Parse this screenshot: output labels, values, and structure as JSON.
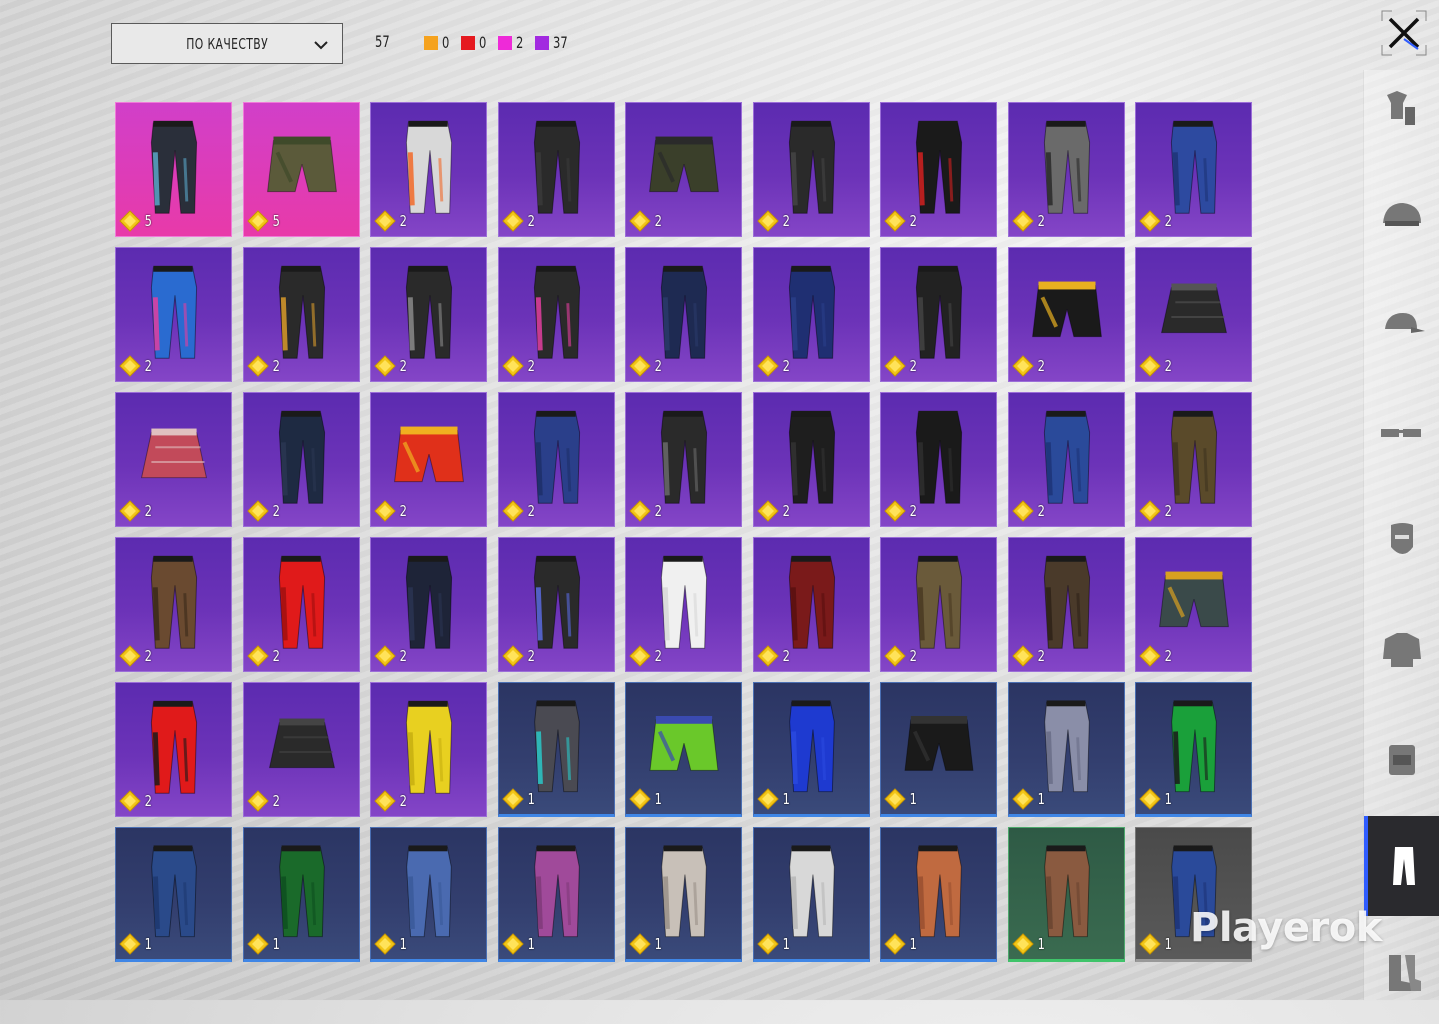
{
  "sort": {
    "label": "ПО КАЧЕСТВУ"
  },
  "stats": {
    "total": "57",
    "counts": [
      {
        "color": "#f5a21e",
        "value": "0"
      },
      {
        "color": "#e5191f",
        "value": "0"
      },
      {
        "color": "#ee2ad8",
        "value": "2"
      },
      {
        "color": "#a22ae0",
        "value": "37"
      }
    ]
  },
  "watermark": "Playerok",
  "nav": [
    {
      "icon": "outfit-icon"
    },
    {
      "icon": "helmet-icon"
    },
    {
      "icon": "cap-icon"
    },
    {
      "icon": "glasses-icon"
    },
    {
      "icon": "mask-icon"
    },
    {
      "icon": "jacket-icon"
    },
    {
      "icon": "backpack-icon"
    },
    {
      "icon": "pants-icon",
      "active": true
    },
    {
      "icon": "boots-icon"
    }
  ],
  "items": [
    {
      "q": "pink",
      "count": "5",
      "c1": "#2a2f3a",
      "c2": "#5aa6c8",
      "type": "pants"
    },
    {
      "q": "pink",
      "count": "5",
      "c1": "#5b5a3a",
      "c2": "#3f4a2a",
      "type": "shorts"
    },
    {
      "q": "purple",
      "count": "2",
      "c1": "#d8d8d8",
      "c2": "#f26a2a",
      "type": "pants"
    },
    {
      "q": "purple",
      "count": "2",
      "c1": "#2a2a2a",
      "c2": "#3a3a3a",
      "type": "pants"
    },
    {
      "q": "purple",
      "count": "2",
      "c1": "#3a3f2a",
      "c2": "#2a2a2a",
      "type": "shorts"
    },
    {
      "q": "purple",
      "count": "2",
      "c1": "#2a2a2a",
      "c2": "#444",
      "type": "pants"
    },
    {
      "q": "purple",
      "count": "2",
      "c1": "#1a1a1a",
      "c2": "#d32020",
      "type": "pants"
    },
    {
      "q": "purple",
      "count": "2",
      "c1": "#6a6a6a",
      "c2": "#2a2a2a",
      "type": "pants"
    },
    {
      "q": "purple",
      "count": "2",
      "c1": "#2d4aa0",
      "c2": "#1e3478",
      "type": "pants"
    },
    {
      "q": "purple",
      "count": "2",
      "c1": "#2a6bd0",
      "c2": "#e33ea0",
      "type": "pants"
    },
    {
      "q": "purple",
      "count": "2",
      "c1": "#2a2a2a",
      "c2": "#d89a2a",
      "type": "pants"
    },
    {
      "q": "purple",
      "count": "2",
      "c1": "#2a2a2a",
      "c2": "#8a8a8a",
      "type": "pants"
    },
    {
      "q": "purple",
      "count": "2",
      "c1": "#2a2a2a",
      "c2": "#e33ea0",
      "type": "pants"
    },
    {
      "q": "purple",
      "count": "2",
      "c1": "#1e2a52",
      "c2": "#2a3a6a",
      "type": "pants"
    },
    {
      "q": "purple",
      "count": "2",
      "c1": "#1f2f72",
      "c2": "#2a3f8a",
      "type": "pants"
    },
    {
      "q": "purple",
      "count": "2",
      "c1": "#222",
      "c2": "#444",
      "type": "pants"
    },
    {
      "q": "purple",
      "count": "2",
      "c1": "#1a1a1a",
      "c2": "#e8b020",
      "type": "shorts"
    },
    {
      "q": "purple",
      "count": "2",
      "c1": "#2a2a2a",
      "c2": "#555",
      "type": "skirt"
    },
    {
      "q": "purple",
      "count": "2",
      "c1": "#c24a5a",
      "c2": "#e0c0c0",
      "type": "skirt"
    },
    {
      "q": "purple",
      "count": "2",
      "c1": "#1e2a42",
      "c2": "#2a3652",
      "type": "pants"
    },
    {
      "q": "purple",
      "count": "2",
      "c1": "#e0301a",
      "c2": "#f0b020",
      "type": "shorts"
    },
    {
      "q": "purple",
      "count": "2",
      "c1": "#2a3f8a",
      "c2": "#1e2f6a",
      "type": "pants"
    },
    {
      "q": "purple",
      "count": "2",
      "c1": "#2a2a2a",
      "c2": "#6a6a6a",
      "type": "pants"
    },
    {
      "q": "purple",
      "count": "2",
      "c1": "#1e1e1e",
      "c2": "#333",
      "type": "pants"
    },
    {
      "q": "purple",
      "count": "2",
      "c1": "#1a1a1a",
      "c2": "#2e2e2e",
      "type": "pants"
    },
    {
      "q": "purple",
      "count": "2",
      "c1": "#2a4a9a",
      "c2": "#1e3478",
      "type": "pants"
    },
    {
      "q": "purple",
      "count": "2",
      "c1": "#5a4a2a",
      "c2": "#3f3420",
      "type": "pants"
    },
    {
      "q": "purple",
      "count": "2",
      "c1": "#6a4a30",
      "c2": "#3a2a1a",
      "type": "pants"
    },
    {
      "q": "purple",
      "count": "2",
      "c1": "#e01a1a",
      "c2": "#a01010",
      "type": "pants"
    },
    {
      "q": "purple",
      "count": "2",
      "c1": "#1e2438",
      "c2": "#2a3452",
      "type": "pants"
    },
    {
      "q": "purple",
      "count": "2",
      "c1": "#2a2a2a",
      "c2": "#5a6ae0",
      "type": "pants"
    },
    {
      "q": "purple",
      "count": "2",
      "c1": "#f0f0f0",
      "c2": "#d8d8d8",
      "type": "pants"
    },
    {
      "q": "purple",
      "count": "2",
      "c1": "#7a1a1a",
      "c2": "#5a1010",
      "type": "pants"
    },
    {
      "q": "purple",
      "count": "2",
      "c1": "#6a5a3a",
      "c2": "#4a3a22",
      "type": "pants"
    },
    {
      "q": "purple",
      "count": "2",
      "c1": "#4a3a2a",
      "c2": "#2e2218",
      "type": "pants"
    },
    {
      "q": "purple",
      "count": "2",
      "c1": "#3a4a4a",
      "c2": "#d8a020",
      "type": "shorts"
    },
    {
      "q": "purple",
      "count": "2",
      "c1": "#e01a1a",
      "c2": "#1a1a1a",
      "type": "pants"
    },
    {
      "q": "purple",
      "count": "2",
      "c1": "#2a2a2a",
      "c2": "#444",
      "type": "skirt"
    },
    {
      "q": "purple",
      "count": "2",
      "c1": "#e8d020",
      "c2": "#c8b010",
      "type": "pants"
    },
    {
      "q": "blue",
      "count": "1",
      "c1": "#4a4a52",
      "c2": "#2ac8c8",
      "type": "pants"
    },
    {
      "q": "blue",
      "count": "1",
      "c1": "#6ac82a",
      "c2": "#3a4ab0",
      "type": "shorts"
    },
    {
      "q": "blue",
      "count": "1",
      "c1": "#1e3ad0",
      "c2": "#2a4ae0",
      "type": "pants"
    },
    {
      "q": "blue",
      "count": "1",
      "c1": "#1a1a1a",
      "c2": "#333",
      "type": "shorts"
    },
    {
      "q": "blue",
      "count": "1",
      "c1": "#8a8ea8",
      "c2": "#6a6e88",
      "type": "pants"
    },
    {
      "q": "blue",
      "count": "1",
      "c1": "#1aa03a",
      "c2": "#1a1a1a",
      "type": "pants"
    },
    {
      "q": "blue",
      "count": "1",
      "c1": "#2a4a8a",
      "c2": "#1e3870",
      "type": "pants"
    },
    {
      "q": "blue",
      "count": "1",
      "c1": "#1a6a2a",
      "c2": "#0e5020",
      "type": "pants"
    },
    {
      "q": "blue",
      "count": "1",
      "c1": "#4a6ab0",
      "c2": "#3a5a9a",
      "type": "pants"
    },
    {
      "q": "blue",
      "count": "1",
      "c1": "#a04a9a",
      "c2": "#803a7a",
      "type": "pants"
    },
    {
      "q": "blue",
      "count": "1",
      "c1": "#c8c0b8",
      "c2": "#9a9088",
      "type": "pants"
    },
    {
      "q": "blue",
      "count": "1",
      "c1": "#d8d8d8",
      "c2": "#b8b8b8",
      "type": "pants"
    },
    {
      "q": "blue",
      "count": "1",
      "c1": "#c06a40",
      "c2": "#9a5030",
      "type": "pants"
    },
    {
      "q": "green",
      "count": "1",
      "c1": "#8a5a40",
      "c2": "#6a4430",
      "type": "pants"
    },
    {
      "q": "gray",
      "count": "1",
      "c1": "#2a4a9a",
      "c2": "#1e3478",
      "type": "pants"
    }
  ]
}
